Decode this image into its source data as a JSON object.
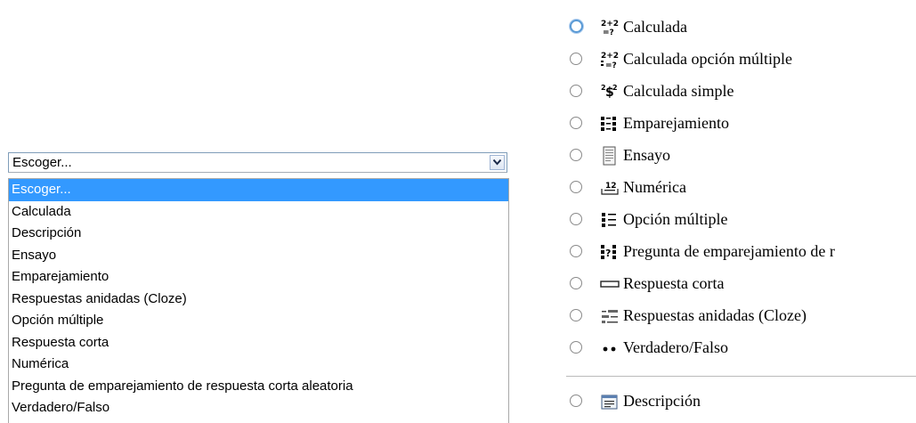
{
  "select": {
    "value": "Escoger...",
    "options": [
      "Escoger...",
      "Calculada",
      "Descripción",
      "Ensayo",
      "Emparejamiento",
      "Respuestas anidadas (Cloze)",
      "Opción múltiple",
      "Respuesta corta",
      "Numérica",
      "Pregunta de emparejamiento de respuesta corta aleatoria",
      "Verdadero/Falso"
    ],
    "highlighted_index": 0
  },
  "radio_list": {
    "items": [
      {
        "label": "Calculada",
        "icon": "calculated-icon",
        "icon_text": "2+2\n=?",
        "focused": true
      },
      {
        "label": "Calculada opción múltiple",
        "icon": "calculated-multichoice-icon",
        "icon_text": "2+2\n=?",
        "focused": false
      },
      {
        "label": "Calculada simple",
        "icon": "calculated-simple-icon",
        "icon_text": "2±2",
        "focused": false
      },
      {
        "label": "Emparejamiento",
        "icon": "matching-icon",
        "icon_text": "",
        "focused": false
      },
      {
        "label": "Ensayo",
        "icon": "essay-icon",
        "icon_text": "",
        "focused": false
      },
      {
        "label": "Numérica",
        "icon": "numerical-icon",
        "icon_text": "12",
        "focused": false
      },
      {
        "label": "Opción múltiple",
        "icon": "multichoice-icon",
        "icon_text": "",
        "focused": false
      },
      {
        "label": "Pregunta de emparejamiento de r",
        "icon": "random-matching-icon",
        "icon_text": "?",
        "focused": false
      },
      {
        "label": "Respuesta corta",
        "icon": "short-answer-icon",
        "icon_text": "",
        "focused": false
      },
      {
        "label": "Respuestas anidadas (Cloze)",
        "icon": "cloze-icon",
        "icon_text": "",
        "focused": false
      },
      {
        "label": "Verdadero/Falso",
        "icon": "true-false-icon",
        "icon_text": "",
        "focused": false
      },
      {
        "label": "Descripción",
        "icon": "description-icon",
        "icon_text": "",
        "focused": false
      }
    ]
  },
  "colors": {
    "highlight": "#3399ff",
    "highlight_text": "#ffffff",
    "select_border": "#7f9db9",
    "focus_ring": "#5a9ad5"
  }
}
